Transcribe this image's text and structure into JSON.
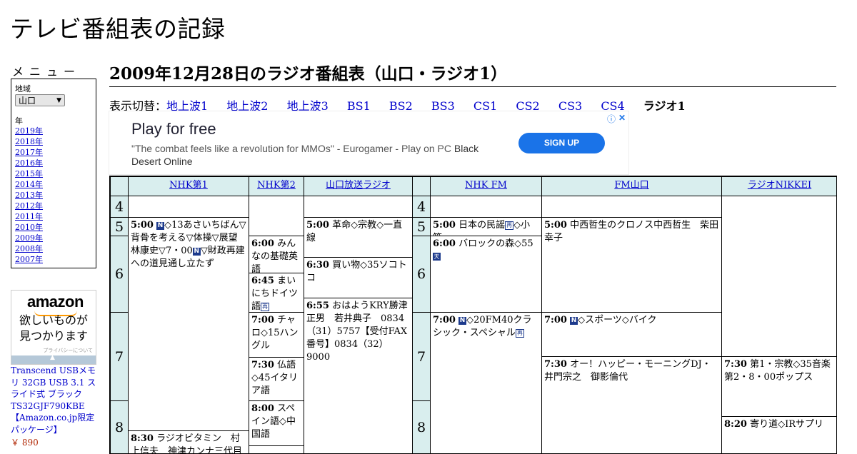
{
  "site_title": "テレビ番組表の記録",
  "menu": {
    "heading": "メニュー",
    "region_label": "地域",
    "region_value": "山口",
    "year_label": "年",
    "years": [
      "2019年",
      "2018年",
      "2017年",
      "2016年",
      "2015年",
      "2014年",
      "2013年",
      "2012年",
      "2011年",
      "2010年",
      "2009年",
      "2008年",
      "2007年"
    ]
  },
  "ad_amazon": {
    "logo": "amazon",
    "tagline_1": "欲しいものが",
    "tagline_2": "見つかります",
    "privacy": "プライバシーについて",
    "product": "Transcend USBメモリ 32GB USB 3.1 スライド式 ブラック TS32GJF790KBE 【Amazon.co.jp限定パッケージ】",
    "price": "￥ 890"
  },
  "page_title": "2009年12月28日のラジオ番組表（山口・ラジオ1）",
  "switcher": {
    "label": "表示切替：",
    "links": [
      "地上波1",
      "地上波2",
      "地上波3",
      "BS1",
      "BS2",
      "BS3",
      "CS1",
      "CS2",
      "CS3",
      "CS4"
    ],
    "current": "ラジオ1"
  },
  "ad_banner": {
    "headline": "Play for free",
    "desc_quote": "\"The combat feels like a revolution for MMOs\" - Eurogamer - Play on PC",
    "desc_em": "Black Desert Online",
    "button": "SIGN UP",
    "info_icon": "info-icon",
    "close_icon": "close-icon"
  },
  "grid": {
    "channels": [
      "NHK第1",
      "NHK第2",
      "山口放送ラジオ",
      "NHK FM",
      "FM山口",
      "ラジオNIKKEI"
    ],
    "hours": [
      "4",
      "5",
      "6",
      "7",
      "8"
    ],
    "badges": {
      "news": "N",
      "rerun": "再",
      "stereo": "天"
    },
    "programs": {
      "nhk1_500": {
        "time": "5:00",
        "pre": "",
        "text": "◇13あさいちばん▽背骨を考える▽体操▽展望　林康史▽7・00",
        "text2": "▽財政再建への道見通し立たず"
      },
      "nhk1_830": {
        "time": "8:30",
        "text": "ラジオビタミン　村上信夫　神津カンナ三代目魚武"
      },
      "nhk2_600": {
        "time": "6:00",
        "text": "みんなの基礎英語"
      },
      "nhk2_645": {
        "time": "6:45",
        "text": "まいにちドイツ語"
      },
      "nhk2_700": {
        "time": "7:00",
        "text": "チャロ◇15ハングル"
      },
      "nhk2_730": {
        "time": "7:30",
        "text": "仏語◇45イタリア語"
      },
      "nhk2_800": {
        "time": "8:00",
        "text": "スペイン語◇中国語"
      },
      "kry_500": {
        "time": "5:00",
        "text": "革命◇宗教◇一直線"
      },
      "kry_630": {
        "time": "6:30",
        "text": "買い物◇35ソコトコ"
      },
      "kry_655": {
        "time": "6:55",
        "text": "おはようKRY勝津正男　若井典子　0834（31）5757【受付FAX番号】0834（32）9000"
      },
      "fm_500": {
        "time": "5:00",
        "text": "日本の民謡",
        "text2": "◇小箱"
      },
      "fm_600": {
        "time": "6:00",
        "text": "バロックの森◇55"
      },
      "fm_700": {
        "time": "7:00",
        "text": "◇20FM40クラシック・スペシャル"
      },
      "fmy_500": {
        "time": "5:00",
        "text": "中西哲生のクロノス中西哲生　柴田幸子"
      },
      "fmy_700": {
        "time": "7:00",
        "text": "◇スポーツ◇バイク"
      },
      "fmy_730": {
        "time": "7:30",
        "text": "オー！ハッピー・モーニングDJ・井門宗之　御影倫代"
      },
      "nikkei_730": {
        "time": "7:30",
        "text": "第1・宗教◇35音楽第2・8・00ポップス"
      },
      "nikkei_820": {
        "time": "8:20",
        "text": "寄り道◇IRサプリ"
      }
    }
  }
}
